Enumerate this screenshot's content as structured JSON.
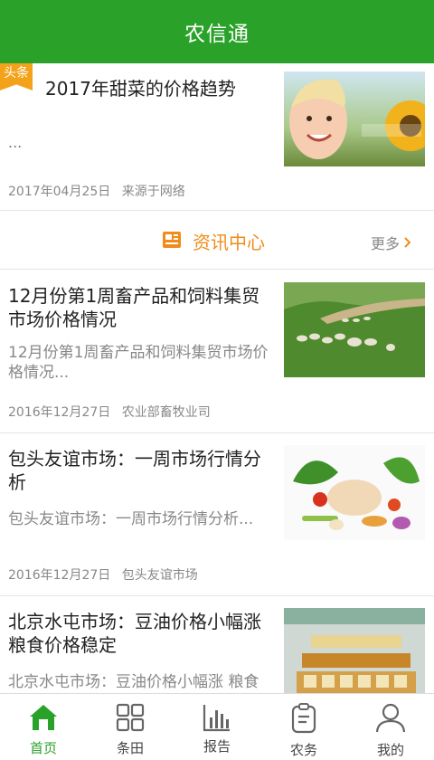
{
  "app": {
    "title": "农信通"
  },
  "headline": {
    "badge": "头条",
    "title": "2017年甜菜的价格趋势",
    "summary": "...",
    "date": "2017年04月25日",
    "source": "来源于网络",
    "image": "child-sunflower-photo"
  },
  "section": {
    "title": "资讯中心",
    "more": "更多"
  },
  "news": [
    {
      "title": "12月份第1周畜产品和饲料集贸市场价格情况",
      "summary": "12月份第1周畜产品和饲料集贸市场价格情况...",
      "date": "2016年12月27日",
      "source": "农业部畜牧业司",
      "image": "sheep-pasture-photo"
    },
    {
      "title": "包头友谊市场：一周市场行情分析",
      "summary": "包头友谊市场：一周市场行情分析...",
      "date": "2016年12月27日",
      "source": "包头友谊市场",
      "image": "vegetables-chicken-photo"
    },
    {
      "title": "北京水屯市场：豆油价格小幅涨 粮食价格稳定",
      "summary": "北京水屯市场：豆油价格小幅涨 粮食",
      "image": "market-stall-photo"
    }
  ],
  "tabs": [
    {
      "label": "首页",
      "icon": "home-icon",
      "active": true
    },
    {
      "label": "条田",
      "icon": "grid-icon",
      "active": false
    },
    {
      "label": "报告",
      "icon": "bar-chart-icon",
      "active": false
    },
    {
      "label": "农务",
      "icon": "clipboard-icon",
      "active": false
    },
    {
      "label": "我的",
      "icon": "user-icon",
      "active": false
    }
  ],
  "colors": {
    "brand": "#2aa22a",
    "accent": "#f08c1a",
    "badge": "#f3a21a"
  }
}
